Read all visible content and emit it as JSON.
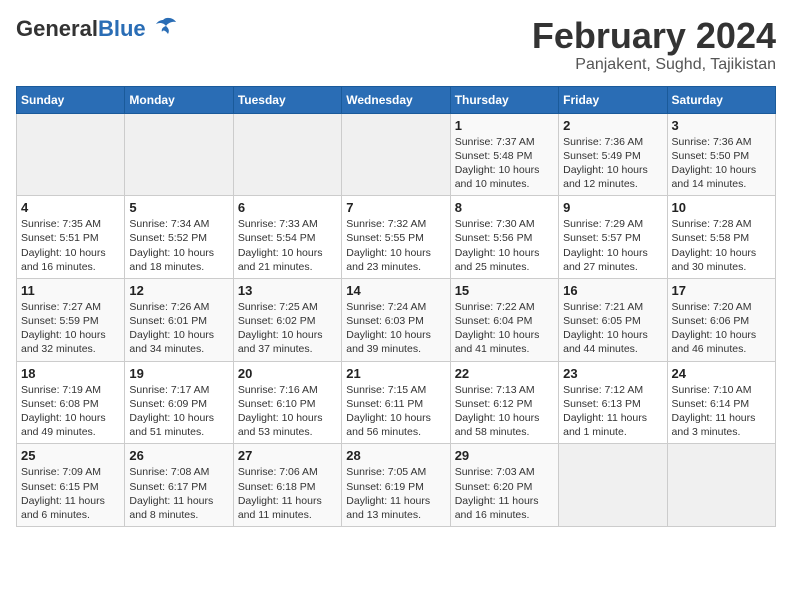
{
  "header": {
    "logo_general": "General",
    "logo_blue": "Blue",
    "main_title": "February 2024",
    "subtitle": "Panjakent, Sughd, Tajikistan"
  },
  "weekdays": [
    "Sunday",
    "Monday",
    "Tuesday",
    "Wednesday",
    "Thursday",
    "Friday",
    "Saturday"
  ],
  "weeks": [
    [
      {
        "day": "",
        "info": ""
      },
      {
        "day": "",
        "info": ""
      },
      {
        "day": "",
        "info": ""
      },
      {
        "day": "",
        "info": ""
      },
      {
        "day": "1",
        "info": "Sunrise: 7:37 AM\nSunset: 5:48 PM\nDaylight: 10 hours\nand 10 minutes."
      },
      {
        "day": "2",
        "info": "Sunrise: 7:36 AM\nSunset: 5:49 PM\nDaylight: 10 hours\nand 12 minutes."
      },
      {
        "day": "3",
        "info": "Sunrise: 7:36 AM\nSunset: 5:50 PM\nDaylight: 10 hours\nand 14 minutes."
      }
    ],
    [
      {
        "day": "4",
        "info": "Sunrise: 7:35 AM\nSunset: 5:51 PM\nDaylight: 10 hours\nand 16 minutes."
      },
      {
        "day": "5",
        "info": "Sunrise: 7:34 AM\nSunset: 5:52 PM\nDaylight: 10 hours\nand 18 minutes."
      },
      {
        "day": "6",
        "info": "Sunrise: 7:33 AM\nSunset: 5:54 PM\nDaylight: 10 hours\nand 21 minutes."
      },
      {
        "day": "7",
        "info": "Sunrise: 7:32 AM\nSunset: 5:55 PM\nDaylight: 10 hours\nand 23 minutes."
      },
      {
        "day": "8",
        "info": "Sunrise: 7:30 AM\nSunset: 5:56 PM\nDaylight: 10 hours\nand 25 minutes."
      },
      {
        "day": "9",
        "info": "Sunrise: 7:29 AM\nSunset: 5:57 PM\nDaylight: 10 hours\nand 27 minutes."
      },
      {
        "day": "10",
        "info": "Sunrise: 7:28 AM\nSunset: 5:58 PM\nDaylight: 10 hours\nand 30 minutes."
      }
    ],
    [
      {
        "day": "11",
        "info": "Sunrise: 7:27 AM\nSunset: 5:59 PM\nDaylight: 10 hours\nand 32 minutes."
      },
      {
        "day": "12",
        "info": "Sunrise: 7:26 AM\nSunset: 6:01 PM\nDaylight: 10 hours\nand 34 minutes."
      },
      {
        "day": "13",
        "info": "Sunrise: 7:25 AM\nSunset: 6:02 PM\nDaylight: 10 hours\nand 37 minutes."
      },
      {
        "day": "14",
        "info": "Sunrise: 7:24 AM\nSunset: 6:03 PM\nDaylight: 10 hours\nand 39 minutes."
      },
      {
        "day": "15",
        "info": "Sunrise: 7:22 AM\nSunset: 6:04 PM\nDaylight: 10 hours\nand 41 minutes."
      },
      {
        "day": "16",
        "info": "Sunrise: 7:21 AM\nSunset: 6:05 PM\nDaylight: 10 hours\nand 44 minutes."
      },
      {
        "day": "17",
        "info": "Sunrise: 7:20 AM\nSunset: 6:06 PM\nDaylight: 10 hours\nand 46 minutes."
      }
    ],
    [
      {
        "day": "18",
        "info": "Sunrise: 7:19 AM\nSunset: 6:08 PM\nDaylight: 10 hours\nand 49 minutes."
      },
      {
        "day": "19",
        "info": "Sunrise: 7:17 AM\nSunset: 6:09 PM\nDaylight: 10 hours\nand 51 minutes."
      },
      {
        "day": "20",
        "info": "Sunrise: 7:16 AM\nSunset: 6:10 PM\nDaylight: 10 hours\nand 53 minutes."
      },
      {
        "day": "21",
        "info": "Sunrise: 7:15 AM\nSunset: 6:11 PM\nDaylight: 10 hours\nand 56 minutes."
      },
      {
        "day": "22",
        "info": "Sunrise: 7:13 AM\nSunset: 6:12 PM\nDaylight: 10 hours\nand 58 minutes."
      },
      {
        "day": "23",
        "info": "Sunrise: 7:12 AM\nSunset: 6:13 PM\nDaylight: 11 hours\nand 1 minute."
      },
      {
        "day": "24",
        "info": "Sunrise: 7:10 AM\nSunset: 6:14 PM\nDaylight: 11 hours\nand 3 minutes."
      }
    ],
    [
      {
        "day": "25",
        "info": "Sunrise: 7:09 AM\nSunset: 6:15 PM\nDaylight: 11 hours\nand 6 minutes."
      },
      {
        "day": "26",
        "info": "Sunrise: 7:08 AM\nSunset: 6:17 PM\nDaylight: 11 hours\nand 8 minutes."
      },
      {
        "day": "27",
        "info": "Sunrise: 7:06 AM\nSunset: 6:18 PM\nDaylight: 11 hours\nand 11 minutes."
      },
      {
        "day": "28",
        "info": "Sunrise: 7:05 AM\nSunset: 6:19 PM\nDaylight: 11 hours\nand 13 minutes."
      },
      {
        "day": "29",
        "info": "Sunrise: 7:03 AM\nSunset: 6:20 PM\nDaylight: 11 hours\nand 16 minutes."
      },
      {
        "day": "",
        "info": ""
      },
      {
        "day": "",
        "info": ""
      }
    ]
  ]
}
